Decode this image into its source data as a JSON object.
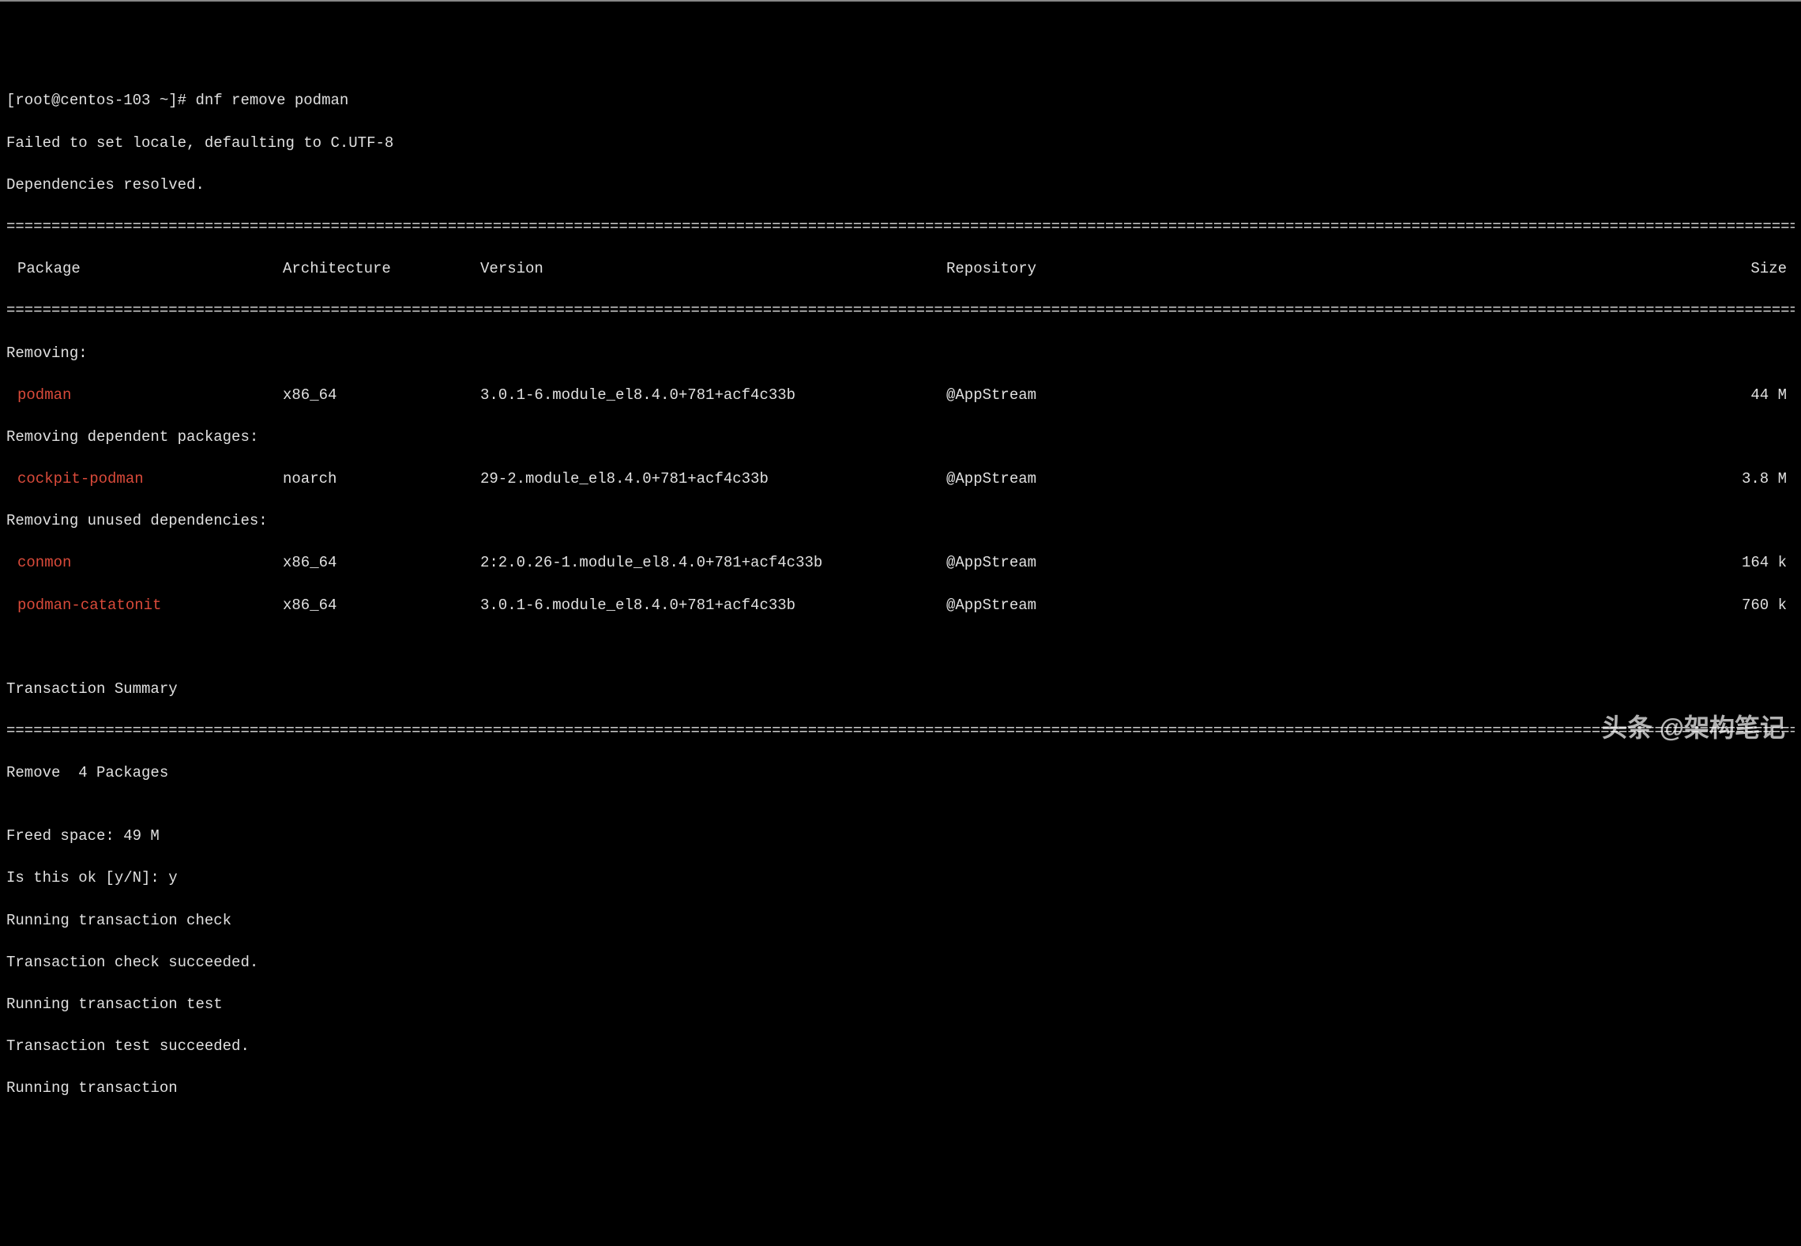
{
  "prompt": {
    "full": "[root@centos-103 ~]# ",
    "command": "dnf remove podman"
  },
  "pre_lines": [
    "Failed to set locale, defaulting to C.UTF-8",
    "Dependencies resolved."
  ],
  "headers": {
    "package": "Package",
    "architecture": "Architecture",
    "version": "Version",
    "repository": "Repository",
    "size": "Size"
  },
  "sections": [
    {
      "title": "Removing:",
      "rows": [
        {
          "pkg": "podman",
          "arch": "x86_64",
          "ver": "3.0.1-6.module_el8.4.0+781+acf4c33b",
          "repo": "@AppStream",
          "size": "44 M"
        }
      ]
    },
    {
      "title": "Removing dependent packages:",
      "rows": [
        {
          "pkg": "cockpit-podman",
          "arch": "noarch",
          "ver": "29-2.module_el8.4.0+781+acf4c33b",
          "repo": "@AppStream",
          "size": "3.8 M"
        }
      ]
    },
    {
      "title": "Removing unused dependencies:",
      "rows": [
        {
          "pkg": "conmon",
          "arch": "x86_64",
          "ver": "2:2.0.26-1.module_el8.4.0+781+acf4c33b",
          "repo": "@AppStream",
          "size": "164 k"
        },
        {
          "pkg": "podman-catatonit",
          "arch": "x86_64",
          "ver": "3.0.1-6.module_el8.4.0+781+acf4c33b",
          "repo": "@AppStream",
          "size": "760 k"
        }
      ]
    }
  ],
  "summary_title": "Transaction Summary",
  "summary_line": "Remove  4 Packages",
  "post_lines": [
    "",
    "Freed space: 49 M",
    "Is this ok [y/N]: y",
    "Running transaction check",
    "Transaction check succeeded.",
    "Running transaction test",
    "Transaction test succeeded.",
    "Running transaction"
  ],
  "watermark": "头条 @架构笔记",
  "divider": "================================================================================================================================================================================================================================================================="
}
